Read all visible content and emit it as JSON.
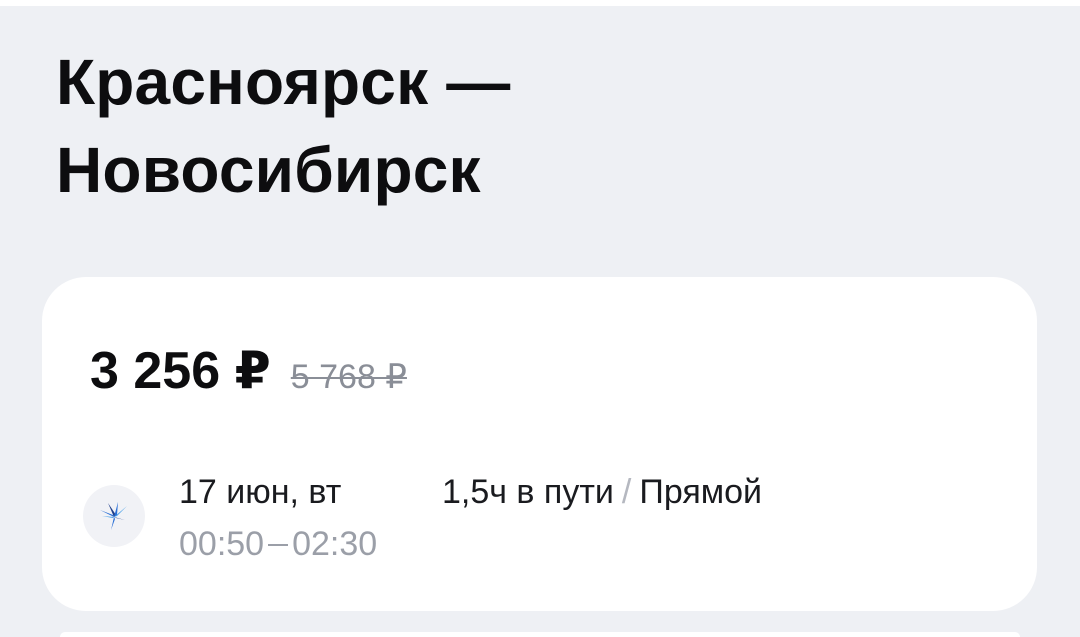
{
  "route": {
    "line1": "Красноярск —",
    "line2": "Новосибирск"
  },
  "offer": {
    "price": "3 256 ₽",
    "old_price": "5 768 ₽",
    "airline_icon": "bird-airline-logo-icon",
    "date": "17 июн, вт",
    "departure": "00:50",
    "arrival": "02:30",
    "duration": "1,5ч в пути",
    "separator": "/",
    "stops": "Прямой"
  },
  "colors": {
    "background": "#eef0f4",
    "card": "#ffffff",
    "text": "#0d0d0f",
    "muted": "#9b9fa8",
    "logo_blue": "#2a6fd6",
    "logo_dark": "#1f3f8a"
  }
}
